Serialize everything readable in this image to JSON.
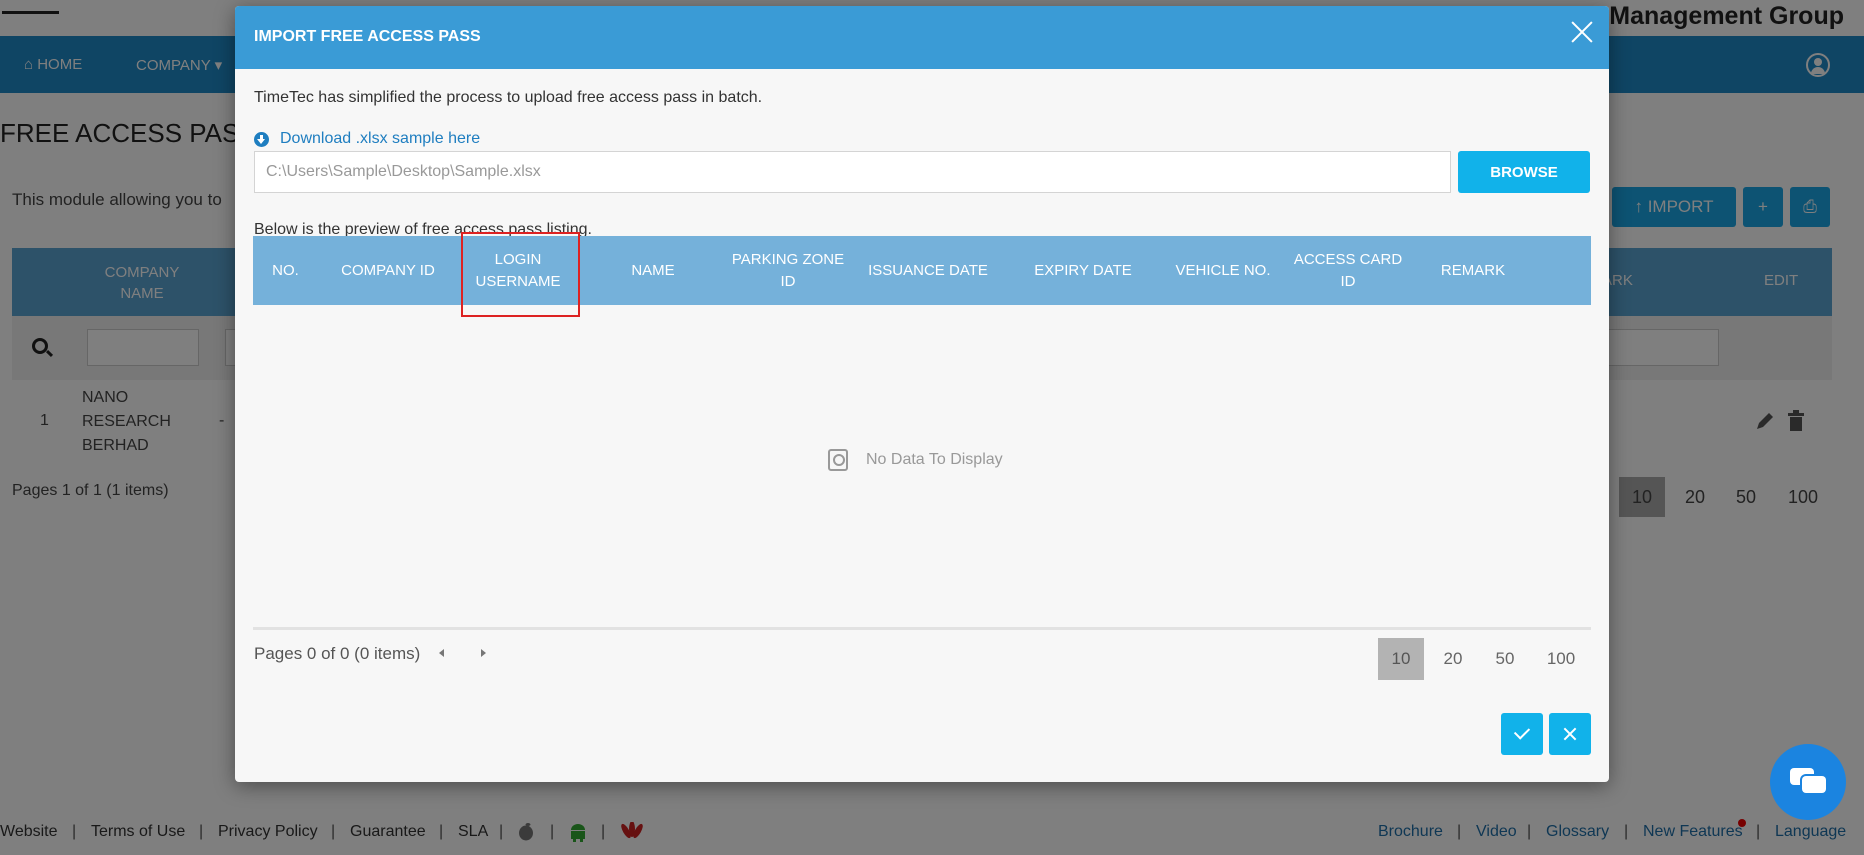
{
  "background": {
    "brand": "ing Management Group",
    "nav": [
      {
        "label": "⌂ HOME"
      },
      {
        "label": "COMPANY ▾"
      }
    ],
    "page_title": "FREE ACCESS PASS",
    "description": "This module allowing you to",
    "buttons": {
      "import": "↑  IMPORT",
      "add": "+",
      "print": "⎙"
    },
    "table_headers": {
      "company_name": "COMPANY NAME",
      "remark": "ARK",
      "edit": "EDIT"
    },
    "row": {
      "no": "1",
      "company": "NANO RESEARCH BERHAD",
      "dash": "-"
    },
    "pager_text": "Pages 1 of 1 (1 items)",
    "page_sizes": [
      "10",
      "20",
      "50",
      "100"
    ],
    "footer_left": [
      "Website",
      "Terms of Use",
      "Privacy Policy",
      "Guarantee",
      "SLA"
    ],
    "footer_right": [
      "Brochure",
      "Video",
      "Glossary",
      "New Features",
      "Language"
    ],
    "colors": {
      "nav": "#1f8ac9",
      "accent": "#11b2ea"
    }
  },
  "modal": {
    "title": "IMPORT FREE ACCESS PASS",
    "intro": "TimeTec has simplified the process to upload free access pass in batch.",
    "download_link": "Download .xlsx sample here",
    "file_path": "C:\\Users\\Sample\\Desktop\\Sample.xlsx",
    "browse_label": "BROWSE",
    "preview_label": "Below is the preview of free access pass listing.",
    "columns": [
      "NO.",
      "COMPANY ID",
      "LOGIN USERNAME",
      "NAME",
      "PARKING ZONE ID",
      "ISSUANCE DATE",
      "EXPIRY DATE",
      "VEHICLE NO.",
      "ACCESS CARD ID",
      "REMARK"
    ],
    "highlighted_column": "LOGIN USERNAME",
    "no_data": "No Data To Display",
    "pager_text": "Pages 0 of 0 (0 items)",
    "page_sizes": [
      "10",
      "20",
      "50",
      "100"
    ],
    "active_page_size": "10",
    "colors": {
      "header": "#3a9bd6",
      "grid_header": "#75b1da",
      "highlight": "#dd2222"
    }
  }
}
